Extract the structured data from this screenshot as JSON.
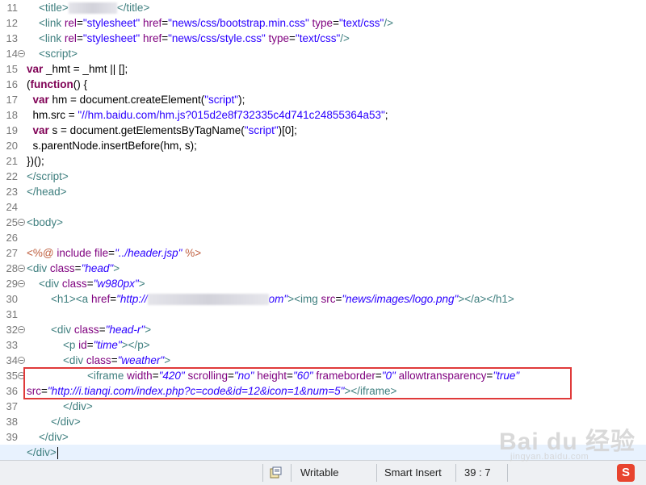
{
  "editor": {
    "lines": [
      {
        "no": "11",
        "html": "    <span class='tag'>&lt;title&gt;</span><span class='blur'></span><span class='tag'>&lt;/title&gt;</span>"
      },
      {
        "no": "12",
        "html": "    <span class='tag'>&lt;link </span><span class='attr'>rel</span><span class='plain'>=</span><span class='val'>\"stylesheet\"</span><span class='tag'> </span><span class='attr'>href</span><span class='plain'>=</span><span class='val'>\"news/css/bootstrap.min.css\"</span><span class='tag'> </span><span class='attr'>type</span><span class='plain'>=</span><span class='val'>\"text/css\"</span><span class='tag'>/&gt;</span>"
      },
      {
        "no": "13",
        "html": "    <span class='tag'>&lt;link </span><span class='attr'>rel</span><span class='plain'>=</span><span class='val'>\"stylesheet\"</span><span class='tag'> </span><span class='attr'>href</span><span class='plain'>=</span><span class='val'>\"news/css/style.css\"</span><span class='tag'> </span><span class='attr'>type</span><span class='plain'>=</span><span class='val'>\"text/css\"</span><span class='tag'>/&gt;</span>"
      },
      {
        "no": "14",
        "fold": true,
        "html": "    <span class='tag'>&lt;script&gt;</span>"
      },
      {
        "no": "15",
        "html": "<span class='kw'>var</span><span class='plain'> _hmt = _hmt || [];</span>"
      },
      {
        "no": "16",
        "html": "<span class='plain'>(</span><span class='kw'>function</span><span class='plain'>() {</span>"
      },
      {
        "no": "17",
        "html": "<span class='plain'>  </span><span class='kw'>var</span><span class='plain'> hm = document.createElement(</span><span class='jstr'>\"script\"</span><span class='plain'>);</span>"
      },
      {
        "no": "18",
        "html": "<span class='plain'>  hm.src = </span><span class='jstr'>\"//hm.baidu.com/hm.js?015d2e8f732335c4d741c24855364a53\"</span><span class='plain'>;</span>"
      },
      {
        "no": "19",
        "html": "<span class='plain'>  </span><span class='kw'>var</span><span class='plain'> s = document.getElementsByTagName(</span><span class='jstr'>\"script\"</span><span class='plain'>)[0];</span>"
      },
      {
        "no": "20",
        "html": "<span class='plain'>  s.parentNode.insertBefore(hm, s);</span>"
      },
      {
        "no": "21",
        "html": "<span class='plain'>})();</span>"
      },
      {
        "no": "22",
        "html": "<span class='tag'>&lt;/script&gt;</span>"
      },
      {
        "no": "23",
        "html": "<span class='tag'>&lt;/head&gt;</span>"
      },
      {
        "no": "24",
        "html": ""
      },
      {
        "no": "25",
        "fold": true,
        "html": "<span class='tag'>&lt;body&gt;</span>"
      },
      {
        "no": "26",
        "html": ""
      },
      {
        "no": "27",
        "html": "<span class='jsp'>&lt;%@</span><span class='plain'> </span><span class='attr'>include</span><span class='plain'> </span><span class='attr'>file</span><span class='plain'>=</span><span class='val'><i>\"../header.jsp\"</i></span><span class='plain'> </span><span class='jsp'>%&gt;</span>"
      },
      {
        "no": "28",
        "fold": true,
        "html": "<span class='tag'>&lt;div </span><span class='attr'>class</span><span class='plain'>=</span><span class='val'><i>\"head\"</i></span><span class='tag'>&gt;</span>"
      },
      {
        "no": "29",
        "fold": true,
        "html": "    <span class='tag'>&lt;div </span><span class='attr'>class</span><span class='plain'>=</span><span class='val'><i>\"w980px\"</i></span><span class='tag'>&gt;</span>"
      },
      {
        "no": "30",
        "html": "        <span class='tag'>&lt;h1&gt;&lt;a </span><span class='attr'>href</span><span class='plain'>=</span><span class='val'><i>\"http://</i></span><span class='blur wide'></span><span class='val'><i>om\"</i></span><span class='tag'>&gt;&lt;img </span><span class='attr'>src</span><span class='plain'>=</span><span class='val'><i>\"news/images/logo.png\"</i></span><span class='tag'>&gt;&lt;/a&gt;&lt;/h1&gt;</span>"
      },
      {
        "no": "31",
        "html": ""
      },
      {
        "no": "32",
        "fold": true,
        "html": "        <span class='tag'>&lt;div </span><span class='attr'>class</span><span class='plain'>=</span><span class='val'><i>\"head-r\"</i></span><span class='tag'>&gt;</span>"
      },
      {
        "no": "33",
        "html": "            <span class='tag'>&lt;p </span><span class='attr'>id</span><span class='plain'>=</span><span class='val'><i>\"time\"</i></span><span class='tag'>&gt;&lt;/p&gt;</span>"
      },
      {
        "no": "34",
        "fold": true,
        "html": "            <span class='tag'>&lt;div </span><span class='attr'>class</span><span class='plain'>=</span><span class='val'><i>\"weather\"</i></span><span class='tag'>&gt;</span>"
      },
      {
        "no": "35",
        "fold": true,
        "html": "                    <span class='tag'>&lt;iframe </span><span class='attr'>width</span><span class='plain'>=</span><span class='val'><i>\"420\"</i></span><span class='tag'> </span><span class='attr'>scrolling</span><span class='plain'>=</span><span class='val'><i>\"no\"</i></span><span class='tag'> </span><span class='attr'>height</span><span class='plain'>=</span><span class='val'><i>\"60\"</i></span><span class='tag'> </span><span class='attr'>frameborder</span><span class='plain'>=</span><span class='val'><i>\"0\"</i></span><span class='tag'> </span><span class='attr'>allowtransparency</span><span class='plain'>=</span><span class='val'><i>\"true\"</i></span>"
      },
      {
        "no": "36",
        "html": "<span class='attr'>src</span><span class='plain'>=</span><span class='val'><i>\"http://i.tianqi.com/index.php?c=code&amp;id=12&amp;icon=1&amp;num=5\"</i></span><span class='tag'>&gt;&lt;/iframe&gt;</span>"
      },
      {
        "no": "37",
        "html": "            <span class='tag'>&lt;/div&gt;</span>"
      },
      {
        "no": "38",
        "html": "        <span class='tag'>&lt;/div&gt;</span>"
      },
      {
        "no": "39",
        "html": "    <span class='tag'>&lt;/div&gt;</span>"
      },
      {
        "no": "",
        "current": true,
        "html": "<span class='tag'>&lt;/div&gt;</span><span class='caret'></span>"
      }
    ]
  },
  "statusbar": {
    "mode": "Writable",
    "insert_mode": "Smart Insert",
    "position": "39 : 7"
  },
  "watermark": {
    "logo": "Bai du 经验",
    "url": "jingyan.baidu.com"
  },
  "tray": {
    "ime_glyph": "S"
  }
}
